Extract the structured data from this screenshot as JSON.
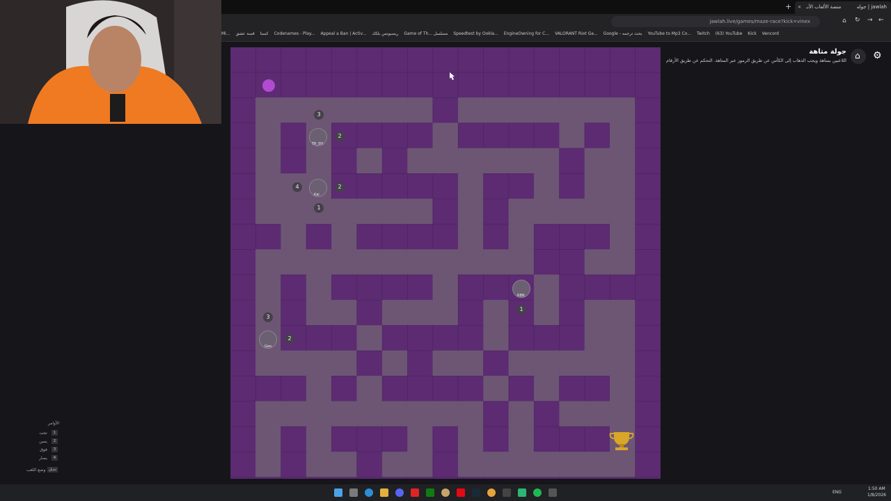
{
  "browser": {
    "tabs": [
      {
        "label": "جوله | jawlah"
      },
      {
        "label": "منصة الألعاب الأنـ"
      }
    ],
    "new_tab_symbol": "+",
    "address": "jawlah.live/games/maze-race?kick=vinex",
    "bookmarks": [
      {
        "label": "Mi..."
      },
      {
        "label": "قصة عشق"
      },
      {
        "label": "كستا"
      },
      {
        "label": "Codenames - Play..."
      },
      {
        "label": "Appeal a Ban | Activ..."
      },
      {
        "label": "ريسبونس بلكك"
      },
      {
        "label": "Game of Th... مسلسل"
      },
      {
        "label": "Speedtest by Ookla..."
      },
      {
        "label": "EngineOwning for C..."
      },
      {
        "label": "VALORANT Riot Ga..."
      },
      {
        "label": "Google - بحث ترجمه"
      },
      {
        "label": "YouTube to Mp3 Co..."
      },
      {
        "label": "Twitch"
      },
      {
        "label": "(63) YouTube"
      },
      {
        "label": "Kick"
      },
      {
        "label": "Vencord"
      }
    ]
  },
  "game": {
    "title": "جولة متاهة",
    "description": "اللاعبين بمتاهة ويجب الذهاب إلى الكأس عن طريق الرموز عبر المتاهة. التحكم عن طريق الأرقام",
    "home_icon": "home-icon",
    "settings_icon": "gear-icon",
    "maze_wall_color": "#5c2b72",
    "maze_path_color": "#6d5674",
    "goal_icon": "trophy-icon",
    "player_marker_color": "#b24bd0"
  },
  "controls": {
    "heading": "الأوامر",
    "items": [
      {
        "key": "1",
        "label": "تحت"
      },
      {
        "key": "2",
        "label": "يمين"
      },
      {
        "key": "3",
        "label": "فوق"
      },
      {
        "key": "4",
        "label": "يسار"
      }
    ],
    "mode_key": "تبديل",
    "mode_label": "وضع اللعب"
  },
  "players": [
    {
      "name": "TR_SH",
      "badges": [
        "3",
        "2"
      ]
    },
    {
      "name": "Kai",
      "badges": [
        "4",
        "2",
        "1"
      ]
    },
    {
      "name": "RBN",
      "badges": [
        "1"
      ]
    },
    {
      "name": "Geo",
      "badges": [
        "3",
        "2"
      ]
    }
  ],
  "taskbar": {
    "language": "ENG",
    "time": "1:50 AM",
    "date": "1/8/2026"
  }
}
